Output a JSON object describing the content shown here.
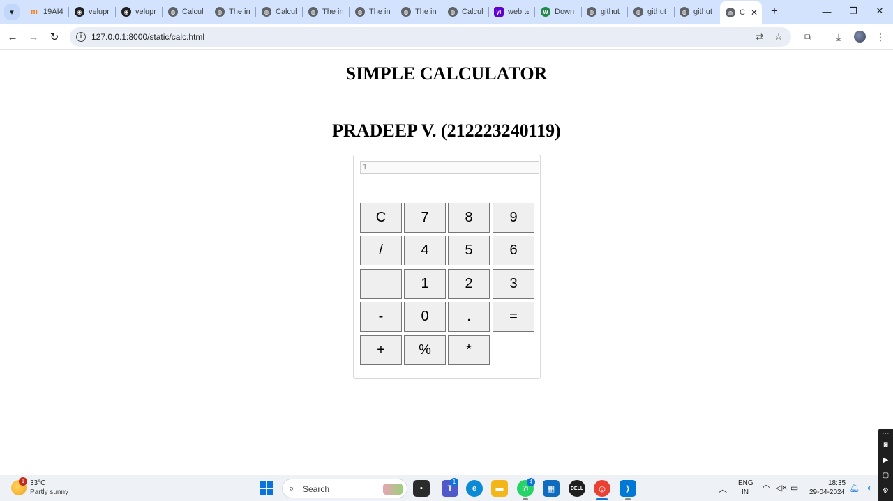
{
  "browser": {
    "tabs": [
      {
        "title": "19AI4",
        "icon": "moodle-icon",
        "color": "#f98012"
      },
      {
        "title": "velupr",
        "icon": "github-icon",
        "color": "#1f1f1f"
      },
      {
        "title": "velupr",
        "icon": "github-icon",
        "color": "#1f1f1f"
      },
      {
        "title": "Calcul",
        "icon": "globe-icon",
        "color": "#5f6368"
      },
      {
        "title": "The in",
        "icon": "globe-icon",
        "color": "#5f6368"
      },
      {
        "title": "Calcul",
        "icon": "globe-icon",
        "color": "#5f6368"
      },
      {
        "title": "The in",
        "icon": "globe-icon",
        "color": "#5f6368"
      },
      {
        "title": "The in",
        "icon": "globe-icon",
        "color": "#5f6368"
      },
      {
        "title": "The in",
        "icon": "globe-icon",
        "color": "#5f6368"
      },
      {
        "title": "Calcul",
        "icon": "globe-icon",
        "color": "#5f6368"
      },
      {
        "title": "web te",
        "icon": "yahoo-icon",
        "color": "#6001d2"
      },
      {
        "title": "Down",
        "icon": "w-icon",
        "color": "#1f8a4c"
      },
      {
        "title": "githut",
        "icon": "globe-icon",
        "color": "#5f6368"
      },
      {
        "title": "githut",
        "icon": "globe-icon",
        "color": "#5f6368"
      },
      {
        "title": "githut",
        "icon": "globe-icon",
        "color": "#5f6368"
      },
      {
        "title": "C",
        "icon": "globe-icon",
        "color": "#5f6368",
        "active": true
      }
    ],
    "url": "127.0.0.1:8000/static/calc.html"
  },
  "page": {
    "title": "SIMPLE CALCULATOR",
    "author": "PRADEEP V. (212223240119)",
    "display_value": "1",
    "keys": [
      [
        "C",
        "7",
        "8",
        "9"
      ],
      [
        "/",
        "4",
        "5",
        "6"
      ],
      [
        "",
        "1",
        "2",
        "3"
      ],
      [
        "-",
        "0",
        ".",
        "="
      ],
      [
        "+",
        "%",
        "*"
      ]
    ]
  },
  "taskbar": {
    "weather_temp": "33°C",
    "weather_desc": "Partly sunny",
    "weather_badge": "1",
    "search_label": "Search",
    "teams_badge": "1",
    "whatsapp_badge": "4",
    "lang_top": "ENG",
    "lang_bottom": "IN",
    "time": "18:35",
    "date": "29-04-2024"
  }
}
